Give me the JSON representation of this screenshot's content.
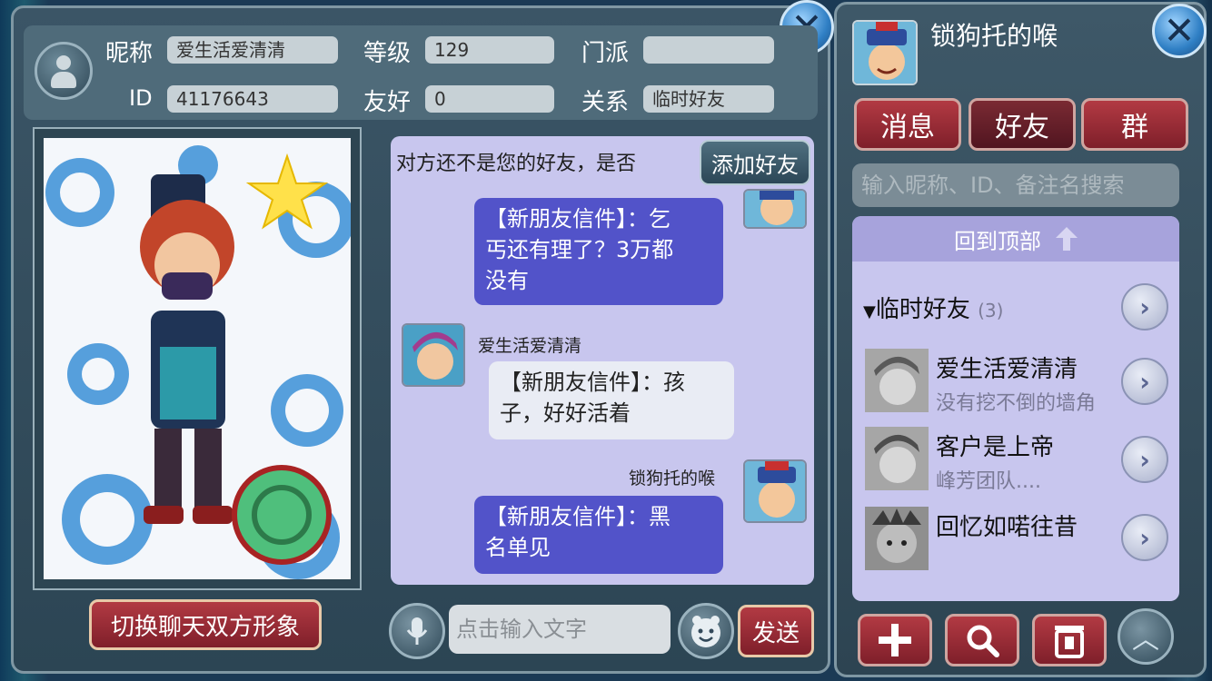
{
  "info": {
    "nickname_label": "昵称",
    "nickname": "爱生活爱清清",
    "level_label": "等级",
    "level": "129",
    "school_label": "门派",
    "school": "",
    "id_label": "ID",
    "id": "41176643",
    "friendship_label": "友好",
    "friendship": "0",
    "relation_label": "关系",
    "relation": "临时好友"
  },
  "switch_button": "切换聊天双方形象",
  "chat": {
    "notice": "对方还不是您的好友，是否",
    "add_friend": "添加好友",
    "messages": [
      {
        "from": "me",
        "text_line1": "【新朋友信件】：乞",
        "text_line2": "丐还有理了？3万都",
        "text_line3": "没有"
      },
      {
        "from": "other",
        "sender": "爱生活爱清清",
        "text_line1": "【新朋友信件】：孩",
        "text_line2": "子，好好活着"
      },
      {
        "from": "me",
        "sender": "锁狗托的喉",
        "text_line1": "【新朋友信件】：黑",
        "text_line2": "名单见"
      }
    ],
    "input_placeholder": "点击输入文字",
    "send": "发送"
  },
  "panel": {
    "player_name": "锁狗托的喉",
    "tabs": [
      "消息",
      "好友",
      "群"
    ],
    "active_tab": "好友",
    "search_placeholder": "输入昵称、ID、备注名搜索",
    "back_to_top": "回到顶部",
    "group_name": "临时好友",
    "group_count": "(3)",
    "friends": [
      {
        "name": "爱生活爱清清",
        "sub": "没有挖不倒的墙角"
      },
      {
        "name": "客户是上帝",
        "sub": "峰芳团队...."
      },
      {
        "name": "回忆如喏往昔",
        "sub": ""
      }
    ]
  },
  "colors": {
    "accent_red": "#9b2a35",
    "chat_bg": "#c8c6ee",
    "my_bubble": "#5253c9"
  }
}
